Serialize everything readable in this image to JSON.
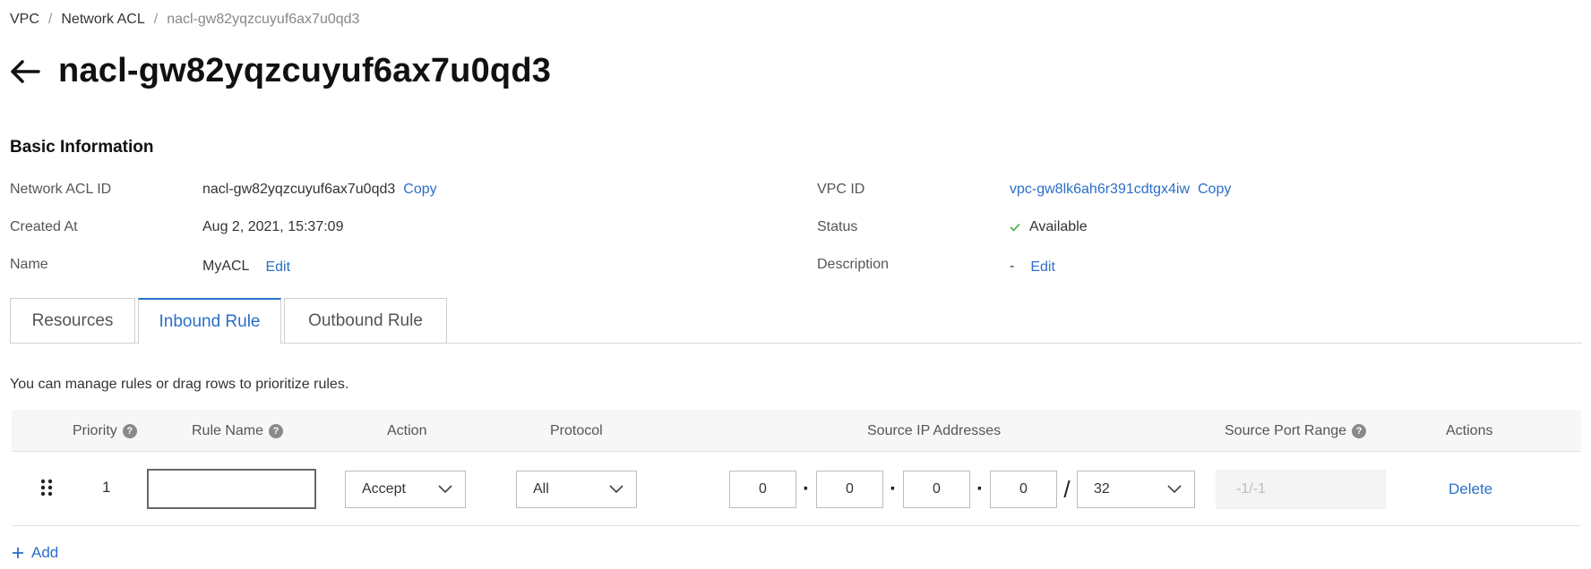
{
  "breadcrumb": {
    "items": [
      "VPC",
      "Network ACL",
      "nacl-gw82yqzcuyuf6ax7u0qd3"
    ],
    "separator": "/"
  },
  "page": {
    "title": "nacl-gw82yqzcuyuf6ax7u0qd3"
  },
  "basic_info": {
    "section_title": "Basic Information",
    "network_acl_id": {
      "label": "Network ACL ID",
      "value": "nacl-gw82yqzcuyuf6ax7u0qd3",
      "copy": "Copy"
    },
    "created_at": {
      "label": "Created At",
      "value": "Aug 2, 2021, 15:37:09"
    },
    "name": {
      "label": "Name",
      "value": "MyACL",
      "edit": "Edit"
    },
    "vpc_id": {
      "label": "VPC ID",
      "value": "vpc-gw8lk6ah6r391cdtgx4iw",
      "copy": "Copy"
    },
    "status": {
      "label": "Status",
      "value": "Available"
    },
    "description": {
      "label": "Description",
      "value": "-",
      "edit": "Edit"
    }
  },
  "tabs": [
    {
      "label": "Resources",
      "active": false
    },
    {
      "label": "Inbound Rule",
      "active": true
    },
    {
      "label": "Outbound Rule",
      "active": false
    }
  ],
  "hint": "You can manage rules or drag rows to prioritize rules.",
  "table": {
    "headers": {
      "priority": "Priority",
      "rule_name": "Rule Name",
      "action": "Action",
      "protocol": "Protocol",
      "source_ip": "Source IP Addresses",
      "source_port": "Source Port Range",
      "actions": "Actions"
    },
    "help_glyph": "?",
    "rows": [
      {
        "priority": "1",
        "rule_name": "",
        "action": "Accept",
        "protocol": "All",
        "ip": [
          "0",
          "0",
          "0",
          "0"
        ],
        "mask": "32",
        "port_placeholder": "-1/-1",
        "delete": "Delete"
      }
    ]
  },
  "add_label": "Add",
  "colors": {
    "link": "#2b6fc7",
    "status_ok": "#52b352"
  }
}
